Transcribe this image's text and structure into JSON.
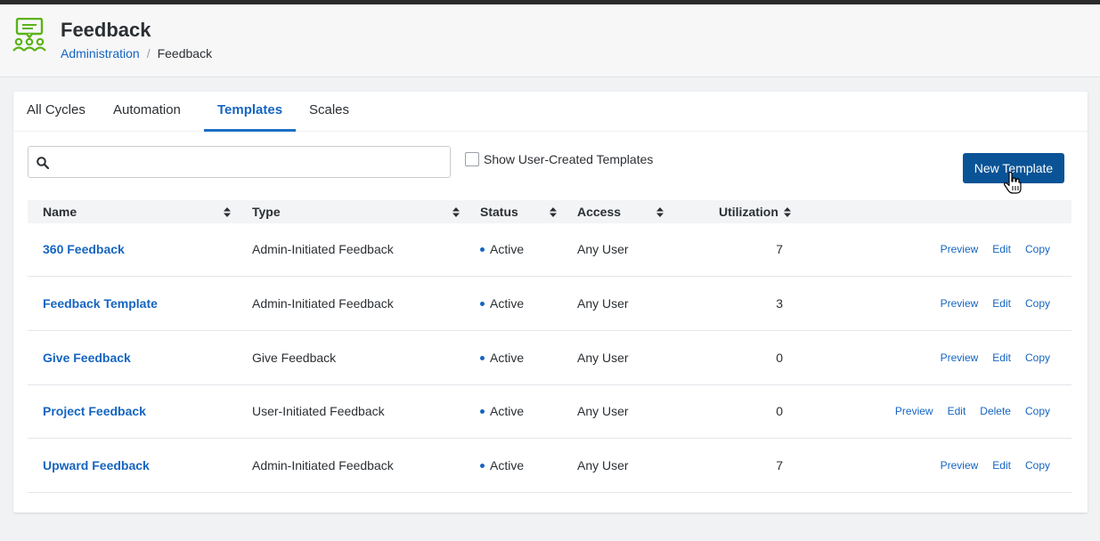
{
  "header": {
    "title": "Feedback",
    "breadcrumb": {
      "parent": "Administration",
      "separator": "/",
      "current": "Feedback"
    },
    "logo_icon": "feedback-group-icon",
    "logo_color": "#5bb318"
  },
  "tabs": [
    {
      "label": "All Cycles"
    },
    {
      "label": "Automation"
    },
    {
      "label": "Templates",
      "active": true
    },
    {
      "label": "Scales"
    }
  ],
  "toolbar": {
    "search_placeholder": "",
    "search_value": "",
    "show_user_created_label": "Show User-Created Templates",
    "show_user_created_checked": false,
    "new_template_label": "New Template"
  },
  "table": {
    "columns": [
      "Name",
      "Type",
      "Status",
      "Access",
      "Utilization"
    ],
    "rows": [
      {
        "name": "360 Feedback",
        "type": "Admin-Initiated Feedback",
        "status": "Active",
        "access": "Any User",
        "utilization": "7",
        "actions": [
          "Preview",
          "Edit",
          "Copy"
        ]
      },
      {
        "name": "Feedback Template",
        "type": "Admin-Initiated Feedback",
        "status": "Active",
        "access": "Any User",
        "utilization": "3",
        "actions": [
          "Preview",
          "Edit",
          "Copy"
        ]
      },
      {
        "name": "Give Feedback",
        "type": "Give Feedback",
        "status": "Active",
        "access": "Any User",
        "utilization": "0",
        "actions": [
          "Preview",
          "Edit",
          "Copy"
        ]
      },
      {
        "name": "Project Feedback",
        "type": "User-Initiated Feedback",
        "status": "Active",
        "access": "Any User",
        "utilization": "0",
        "actions": [
          "Preview",
          "Edit",
          "Delete",
          "Copy"
        ]
      },
      {
        "name": "Upward Feedback",
        "type": "Admin-Initiated Feedback",
        "status": "Active",
        "access": "Any User",
        "utilization": "7",
        "actions": [
          "Preview",
          "Edit",
          "Copy"
        ]
      }
    ]
  },
  "colors": {
    "accent": "#1565c0",
    "primary_button": "#0a5396",
    "status_dot": "#1565c0"
  }
}
